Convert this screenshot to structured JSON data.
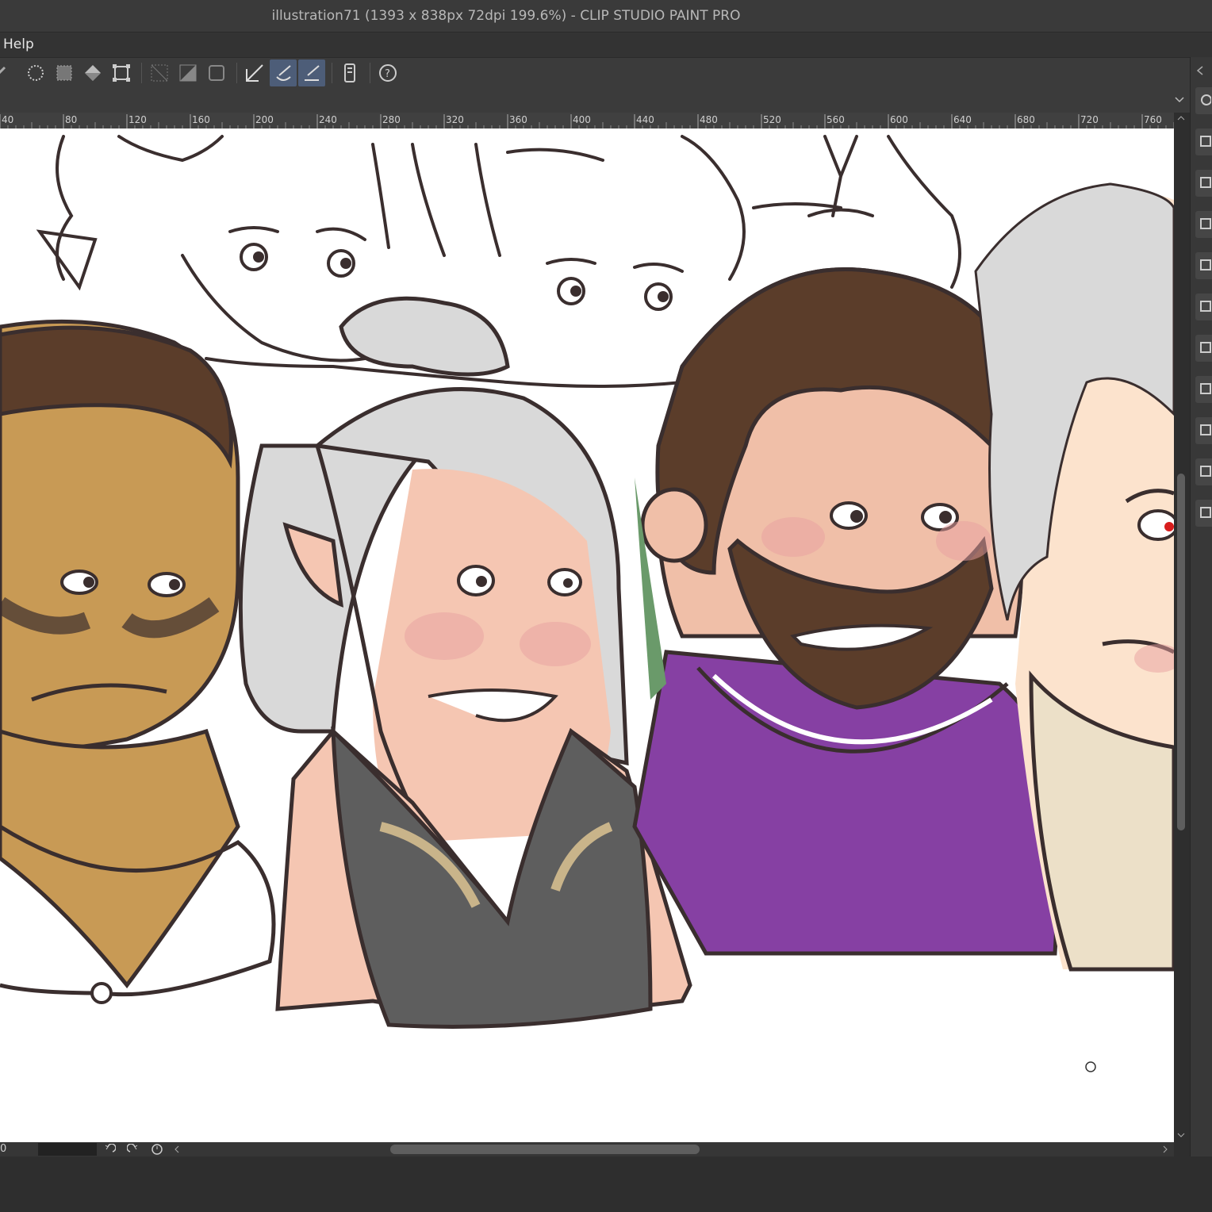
{
  "window": {
    "title": "illustration71 (1393 x 838px 72dpi 199.6%)  - CLIP STUDIO PAINT PRO"
  },
  "menu": {
    "items": [
      {
        "label": "Help"
      }
    ]
  },
  "toolbar": {
    "icons": [
      "partial-arrow-icon",
      "select-all-icon",
      "deselect-icon",
      "fill-icon",
      "transform-icon",
      "hide-selection-icon",
      "invert-selection-icon",
      "selection-border-icon",
      "snap-to-ruler-icon",
      "snap-to-special-ruler-icon",
      "snap-to-grid-icon",
      "smartphone-icon",
      "help-icon"
    ]
  },
  "ruler": {
    "ticks": [
      "40",
      "80",
      "120",
      "160",
      "200",
      "240",
      "280",
      "320",
      "360",
      "400",
      "440",
      "480",
      "520",
      "560",
      "600",
      "640",
      "680",
      "720",
      "760"
    ]
  },
  "statusbar": {
    "zoom_partial": "0"
  },
  "colors": {
    "accent_active": "#4d5d78",
    "skin_tan": "#c89a55",
    "shirt_purple": "#8640a3",
    "hair_brown": "#5b3d2a",
    "hair_silver": "#d9d9d9"
  }
}
